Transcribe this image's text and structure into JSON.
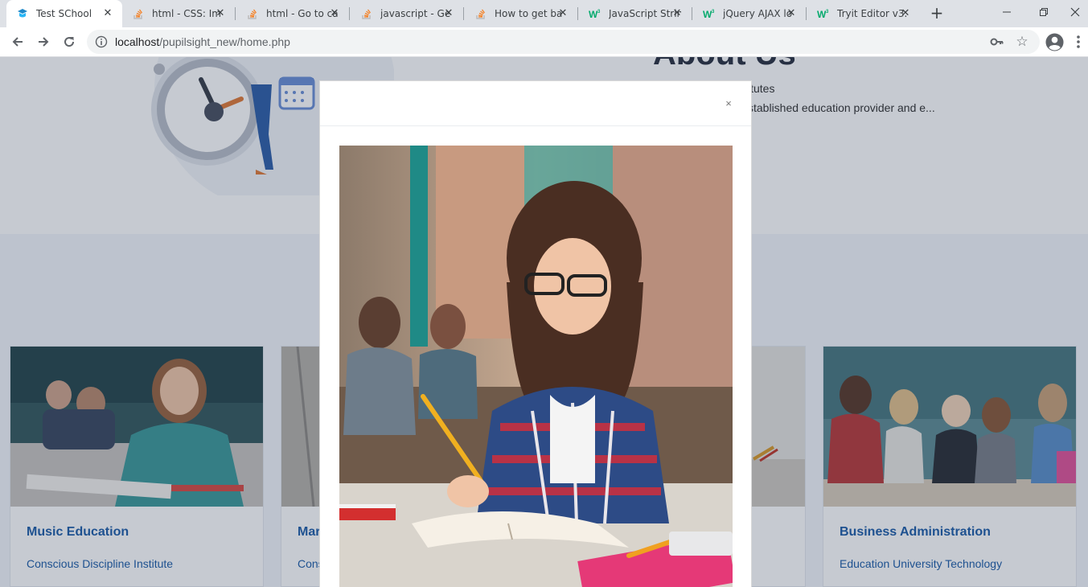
{
  "browser": {
    "tabs": [
      {
        "title": "Test SChool",
        "active": true,
        "favicon": "school-logo-icon"
      },
      {
        "title": "html - CSS: Im",
        "active": false,
        "favicon": "stackoverflow-icon"
      },
      {
        "title": "html - Go to ca",
        "active": false,
        "favicon": "stackoverflow-icon"
      },
      {
        "title": "javascript - Ge",
        "active": false,
        "favicon": "stackoverflow-icon"
      },
      {
        "title": "How to get ba",
        "active": false,
        "favicon": "stackoverflow-icon"
      },
      {
        "title": "JavaScript Strin",
        "active": false,
        "favicon": "w3schools-icon"
      },
      {
        "title": "jQuery AJAX lo",
        "active": false,
        "favicon": "w3schools-icon"
      },
      {
        "title": "Tryit Editor v3.",
        "active": false,
        "favicon": "w3schools-icon"
      }
    ],
    "close_glyph": "✕",
    "new_tab_glyph": "+",
    "address": {
      "host": "localhost",
      "path": "/pupilsight_new/home.php"
    }
  },
  "page": {
    "about": {
      "heading": "About Us",
      "line1": "itutes",
      "line2": "stablished education provider and e..."
    },
    "courses": [
      {
        "title": "Music Education",
        "subtitle": "Conscious Discipline Institute"
      },
      {
        "title": "Mar",
        "subtitle": "Cons"
      },
      {
        "title": "",
        "subtitle": ""
      },
      {
        "title": "Business Administration",
        "subtitle": "Education University Technology"
      }
    ]
  },
  "modal": {
    "close_label": "×"
  },
  "colors": {
    "accent": "#1f5ea8",
    "tabstrip": "#dee1e6",
    "overlay": "rgba(28,44,72,0.25)"
  }
}
